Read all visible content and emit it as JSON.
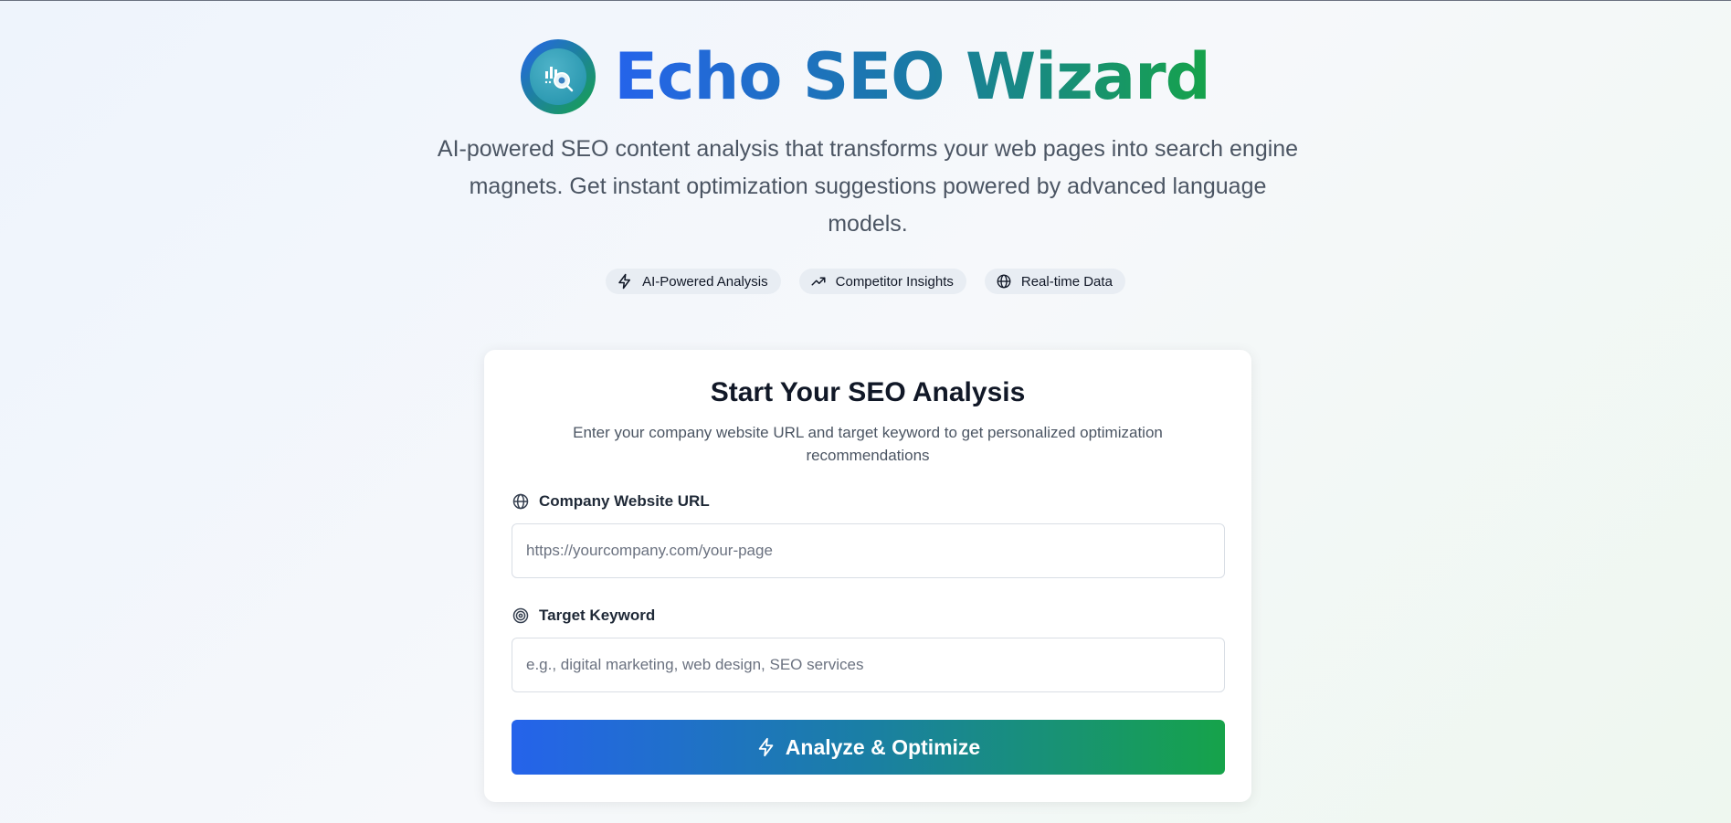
{
  "header": {
    "title": "Echo SEO Wizard",
    "subtitle": "AI-powered SEO content analysis that transforms your web pages into search engine magnets. Get instant optimization suggestions powered by advanced language models."
  },
  "features": [
    {
      "label": "AI-Powered Analysis",
      "icon": "lightning-icon"
    },
    {
      "label": "Competitor Insights",
      "icon": "trending-up-icon"
    },
    {
      "label": "Real-time Data",
      "icon": "globe-icon"
    }
  ],
  "form": {
    "title": "Start Your SEO Analysis",
    "description": "Enter your company website URL and target keyword to get personalized optimization recommendations",
    "url_label": "Company Website URL",
    "url_placeholder": "https://yourcompany.com/your-page",
    "url_value": "",
    "keyword_label": "Target Keyword",
    "keyword_placeholder": "e.g., digital marketing, web design, SEO services",
    "keyword_value": "",
    "submit_label": "Analyze & Optimize"
  },
  "colors": {
    "brand_blue": "#2563eb",
    "brand_green": "#16a34a"
  }
}
